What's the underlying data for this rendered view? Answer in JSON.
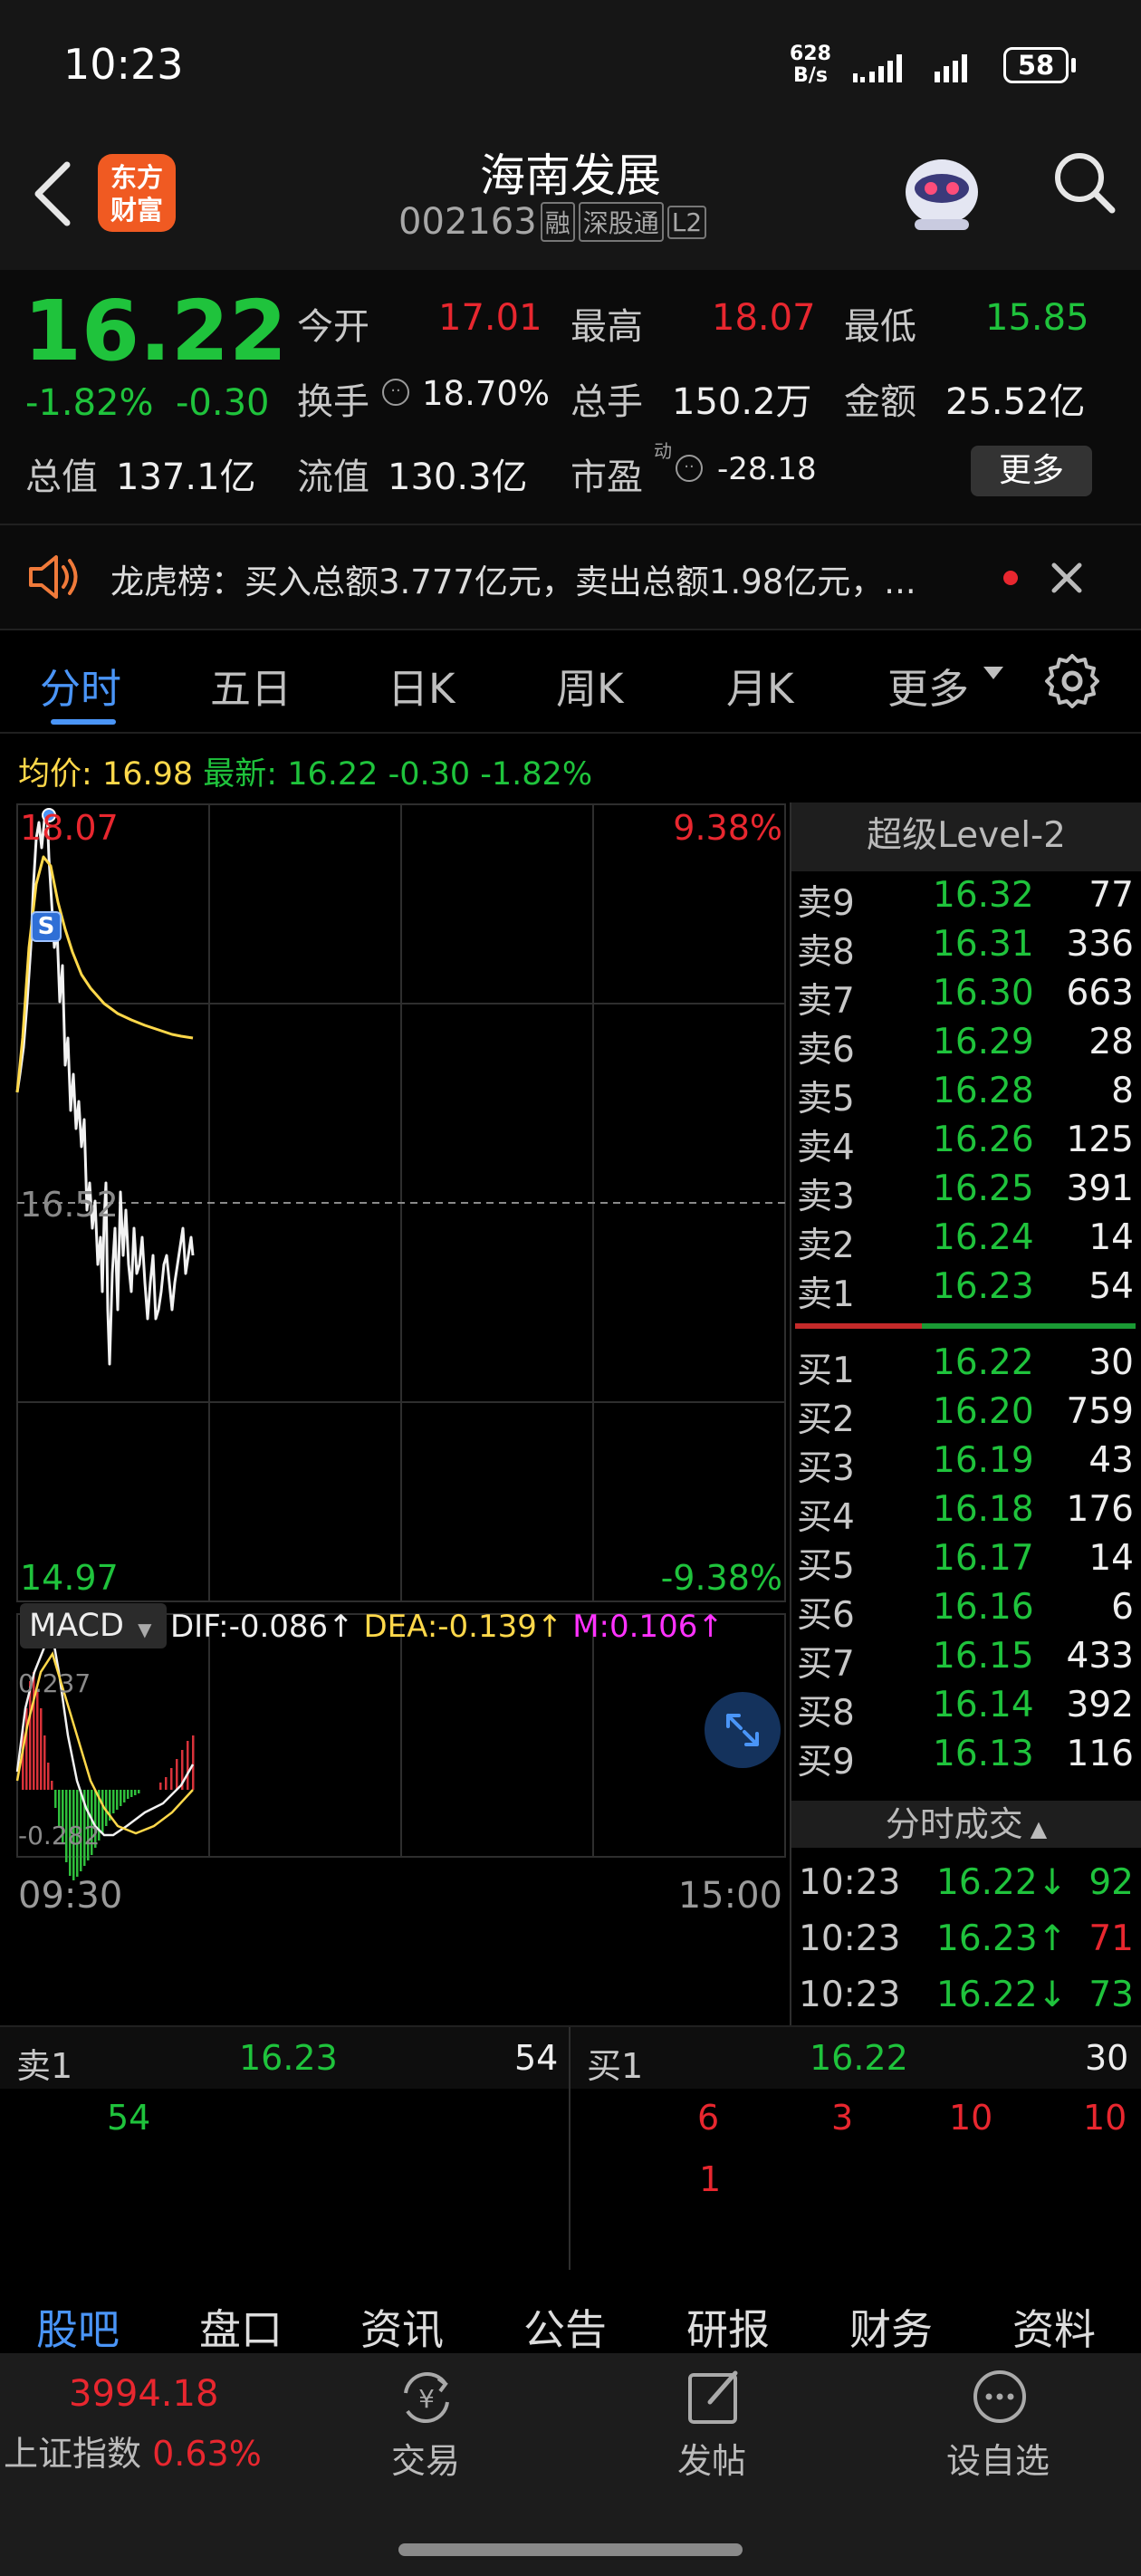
{
  "status": {
    "time": "10:23",
    "net_speed_num": "628",
    "net_speed_unit": "B/s",
    "battery": "58"
  },
  "header": {
    "stock_name": "海南发展",
    "stock_code": "002163",
    "badges": [
      "融",
      "深股通",
      "L2"
    ],
    "logo_line1": "东方",
    "logo_line2": "财富"
  },
  "quote": {
    "price": "16.22",
    "change_pct": "-1.82%",
    "change": "-0.30",
    "open_label": "今开",
    "open": "17.01",
    "high_label": "最高",
    "high": "18.07",
    "low_label": "最低",
    "low": "15.85",
    "turnover_label": "换手",
    "turnover": "18.70%",
    "volume_label": "总手",
    "volume": "150.2万",
    "amount_label": "金额",
    "amount": "25.52亿",
    "mktcap_label": "总值",
    "mktcap": "137.1亿",
    "float_label": "流值",
    "float_cap": "130.3亿",
    "pe_label": "市盈",
    "pe_super": "动",
    "pe": "-28.18",
    "more_button": "更多"
  },
  "notice": {
    "text": "龙虎榜：买入总额3.777亿元，卖出总额1.98亿元，..."
  },
  "chart_tabs": [
    "分时",
    "五日",
    "日K",
    "周K",
    "月K",
    "更多"
  ],
  "chart_info": {
    "avg_label": "均价:",
    "avg": "16.98",
    "latest_label": "最新:",
    "latest": "16.22",
    "latest_change": "-0.30",
    "latest_pct": "-1.82%"
  },
  "chart_data": {
    "type": "line",
    "title": "",
    "y_top_label": "18.07",
    "y_mid_label": "16.52",
    "y_bottom_label": "14.97",
    "pct_top_label": "9.38%",
    "pct_bottom_label": "-9.38%",
    "ylim": [
      14.97,
      18.07
    ],
    "x_start_label": "09:30",
    "x_end_label": "15:00",
    "macd": {
      "label": "MACD",
      "dif": "DIF:-0.086",
      "dea": "DEA:-0.139",
      "m": "M:0.106",
      "top_label": "0.237",
      "bottom_label": "-0.282"
    }
  },
  "orderbook": {
    "title": "超级Level-2",
    "asks": [
      {
        "label": "卖9",
        "price": "16.32",
        "vol": "77"
      },
      {
        "label": "卖8",
        "price": "16.31",
        "vol": "336"
      },
      {
        "label": "卖7",
        "price": "16.30",
        "vol": "663"
      },
      {
        "label": "卖6",
        "price": "16.29",
        "vol": "28"
      },
      {
        "label": "卖5",
        "price": "16.28",
        "vol": "8"
      },
      {
        "label": "卖4",
        "price": "16.26",
        "vol": "125"
      },
      {
        "label": "卖3",
        "price": "16.25",
        "vol": "391"
      },
      {
        "label": "卖2",
        "price": "16.24",
        "vol": "14"
      },
      {
        "label": "卖1",
        "price": "16.23",
        "vol": "54"
      }
    ],
    "bids": [
      {
        "label": "买1",
        "price": "16.22",
        "vol": "30"
      },
      {
        "label": "买2",
        "price": "16.20",
        "vol": "759"
      },
      {
        "label": "买3",
        "price": "16.19",
        "vol": "43"
      },
      {
        "label": "买4",
        "price": "16.18",
        "vol": "176"
      },
      {
        "label": "买5",
        "price": "16.17",
        "vol": "14"
      },
      {
        "label": "买6",
        "price": "16.16",
        "vol": "6"
      },
      {
        "label": "买7",
        "price": "16.15",
        "vol": "433"
      },
      {
        "label": "买8",
        "price": "16.14",
        "vol": "392"
      },
      {
        "label": "买9",
        "price": "16.13",
        "vol": "116"
      }
    ],
    "ticks_title": "分时成交",
    "ticks": [
      {
        "time": "10:23",
        "price": "16.22↓",
        "vol": "92"
      },
      {
        "time": "10:23",
        "price": "16.23↑",
        "vol": "71"
      },
      {
        "time": "10:23",
        "price": "16.22↓",
        "vol": "73"
      }
    ]
  },
  "queue": {
    "sell_label": "卖1",
    "sell_price": "16.23",
    "sell_vol": "54",
    "sell_orders": [
      "54"
    ],
    "buy_label": "买1",
    "buy_price": "16.22",
    "buy_vol": "30",
    "buy_orders": [
      "6",
      "3",
      "10",
      "10",
      "1"
    ]
  },
  "bottom_tabs": [
    "股吧",
    "盘口",
    "资讯",
    "公告",
    "研报",
    "财务",
    "资料"
  ],
  "bottom_nav": {
    "index_value": "3994.18",
    "index_name": "上证指数",
    "index_pct": "0.63%",
    "trade": "交易",
    "post": "发帖",
    "watchlist": "设自选"
  },
  "colors": {
    "up": "#e8272f",
    "down": "#1fc33c",
    "accent": "#3a8ef5",
    "avg_line": "#ffd84a"
  }
}
